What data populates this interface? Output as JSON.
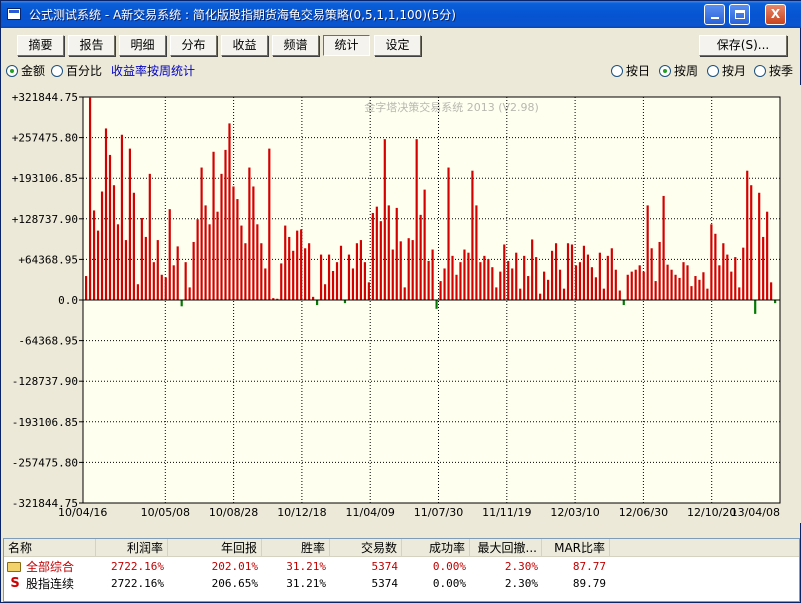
{
  "window": {
    "title": "公式测试系统 - A新交易系统 : 简化版股指期货海龟交易策略(0,5,1,1,100)(5分)",
    "minimize": "_",
    "maximize": "□",
    "close": "X"
  },
  "toolbar": {
    "tabs": [
      "摘要",
      "报告",
      "明细",
      "分布",
      "收益",
      "频谱",
      "统计",
      "设定"
    ],
    "active_tab": "统计",
    "save_label": "保存(S)..."
  },
  "options": {
    "amount_label": "金额",
    "percent_label": "百分比",
    "amount_selected": true,
    "weekly_stat_label": "收益率按周统计",
    "period_options": [
      {
        "label": "按日",
        "selected": false
      },
      {
        "label": "按周",
        "selected": true
      },
      {
        "label": "按月",
        "selected": false
      },
      {
        "label": "按季",
        "selected": false
      }
    ]
  },
  "chart_data": {
    "type": "bar",
    "watermark": "金字塔决策交易系统 2013 (V2.98)",
    "y_ticks": [
      "+321844.75",
      "+257475.80",
      "+193106.85",
      "+128737.90",
      "+64368.95",
      "0.0",
      "-64368.95",
      "-128737.90",
      "-193106.85",
      "-257475.80",
      "-321844.75"
    ],
    "ylim": [
      -321844.75,
      321844.75
    ],
    "x_ticks": [
      "10/04/16",
      "10/05/08",
      "10/08/28",
      "10/12/18",
      "11/04/09",
      "11/07/30",
      "11/11/19",
      "12/03/10",
      "12/06/30",
      "12/10/20",
      "13/04/08"
    ],
    "grid": true,
    "colors": {
      "positive": "#d40000",
      "negative": "#007a00",
      "plot_bg": "#fffff0",
      "grid": "#000000"
    },
    "values": [
      38000,
      321844,
      142000,
      110000,
      172000,
      272000,
      230000,
      182000,
      120000,
      262000,
      95000,
      240000,
      170000,
      25000,
      130000,
      100000,
      200000,
      60000,
      95000,
      40000,
      36000,
      144000,
      55000,
      85000,
      -10000,
      60000,
      20000,
      92000,
      128000,
      210000,
      150000,
      120000,
      235000,
      140000,
      200000,
      238000,
      280000,
      180000,
      160000,
      118000,
      90000,
      210000,
      180000,
      120000,
      90000,
      50000,
      240000,
      3000,
      2000,
      58000,
      118000,
      100000,
      78000,
      110000,
      112000,
      82000,
      90000,
      5000,
      -8000,
      72000,
      25000,
      72000,
      46000,
      60000,
      86000,
      -5000,
      72000,
      50000,
      90000,
      95000,
      60000,
      28000,
      138000,
      148000,
      125000,
      255000,
      150000,
      80000,
      146000,
      93000,
      20000,
      98000,
      95000,
      255000,
      135000,
      175000,
      62000,
      80000,
      -14000,
      30000,
      50000,
      210000,
      70000,
      40000,
      60000,
      80000,
      75000,
      205000,
      150000,
      60000,
      70000,
      65000,
      52000,
      20000,
      45000,
      88000,
      62000,
      50000,
      75000,
      18000,
      70000,
      38000,
      96000,
      68000,
      10000,
      45000,
      32000,
      78000,
      90000,
      48000,
      18000,
      90000,
      88000,
      55000,
      60000,
      86000,
      72000,
      52000,
      36000,
      75000,
      18000,
      70000,
      82000,
      48000,
      15000,
      -8000,
      40000,
      45000,
      48000,
      55000,
      45000,
      150000,
      82000,
      30000,
      92000,
      165000,
      56000,
      48000,
      40000,
      35000,
      60000,
      55000,
      22000,
      38000,
      32000,
      44000,
      18000,
      120000,
      105000,
      55000,
      90000,
      72000,
      45000,
      68000,
      20000,
      83000,
      205000,
      182000,
      -22000,
      170000,
      100000,
      140000,
      28000,
      -5000
    ],
    "series": [
      {
        "name": "",
        "values": []
      }
    ]
  },
  "table": {
    "headers": [
      "名称",
      "利润率",
      "年回报",
      "胜率",
      "交易数",
      "成功率",
      "最大回撤...",
      "MAR比率"
    ],
    "rows": [
      {
        "name": "全部综合",
        "icon": "folder-icon",
        "profit": "2722.16%",
        "annual": "202.01%",
        "win": "31.21%",
        "trades": "5374",
        "success": "0.00%",
        "drawdown": "2.30%",
        "mar": "87.77"
      },
      {
        "name": "股指连续",
        "icon": "s-icon",
        "profit": "2722.16%",
        "annual": "206.65%",
        "win": "31.21%",
        "trades": "5374",
        "success": "0.00%",
        "drawdown": "2.30%",
        "mar": "89.79"
      }
    ]
  }
}
